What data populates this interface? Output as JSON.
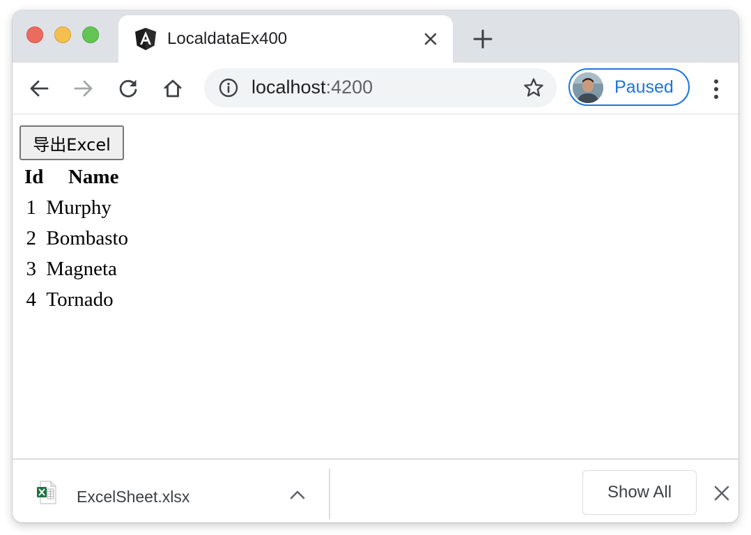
{
  "browser": {
    "tab": {
      "title": "LocaldataEx400",
      "favicon": "angular-icon"
    },
    "address_bar": {
      "host": "localhost",
      "port": ":4200"
    },
    "profile": {
      "label": "Paused"
    }
  },
  "page": {
    "export_button_label": "导出Excel",
    "table": {
      "headers": [
        "Id",
        "Name"
      ],
      "rows": [
        {
          "id": "1",
          "name": "Murphy"
        },
        {
          "id": "2",
          "name": "Bombasto"
        },
        {
          "id": "3",
          "name": "Magneta"
        },
        {
          "id": "4",
          "name": "Tornado"
        }
      ]
    }
  },
  "downloads": {
    "item": {
      "filename": "ExcelSheet.xlsx",
      "icon": "excel-file-icon"
    },
    "show_all_label": "Show All"
  },
  "colors": {
    "accent": "#1a73e8",
    "tabstrip": "#dee1e6",
    "omnibox": "#f1f3f4"
  }
}
